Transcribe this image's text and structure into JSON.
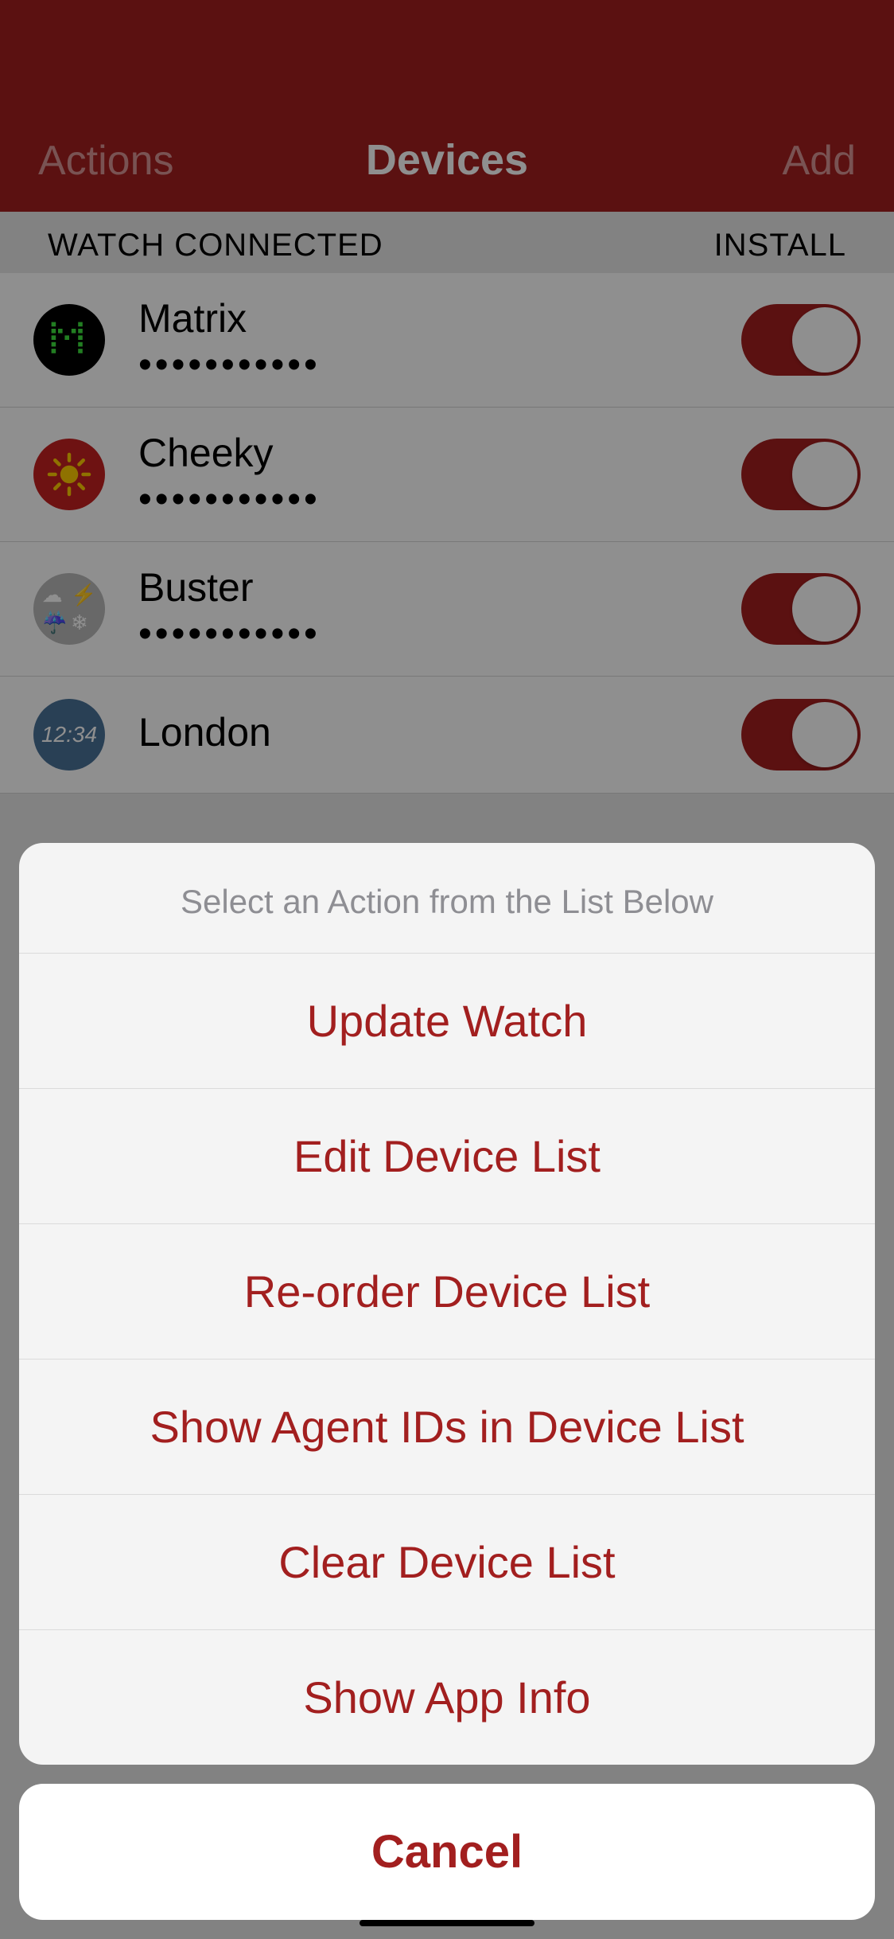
{
  "header": {
    "left": "Actions",
    "title": "Devices",
    "right": "Add"
  },
  "section": {
    "left": "WATCH CONNECTED",
    "right": "INSTALL"
  },
  "devices": [
    {
      "name": "Matrix",
      "dots": "•••••••••••"
    },
    {
      "name": "Cheeky",
      "dots": "•••••••••••"
    },
    {
      "name": "Buster",
      "dots": "•••••••••••"
    },
    {
      "name": "London",
      "dots": ""
    }
  ],
  "londonTime": "12:34",
  "actionSheet": {
    "title": "Select an Action from the List Below",
    "items": [
      "Update Watch",
      "Edit Device List",
      "Re-order Device List",
      "Show Agent IDs in Device List",
      "Clear Device List",
      "Show App Info"
    ],
    "cancel": "Cancel"
  }
}
